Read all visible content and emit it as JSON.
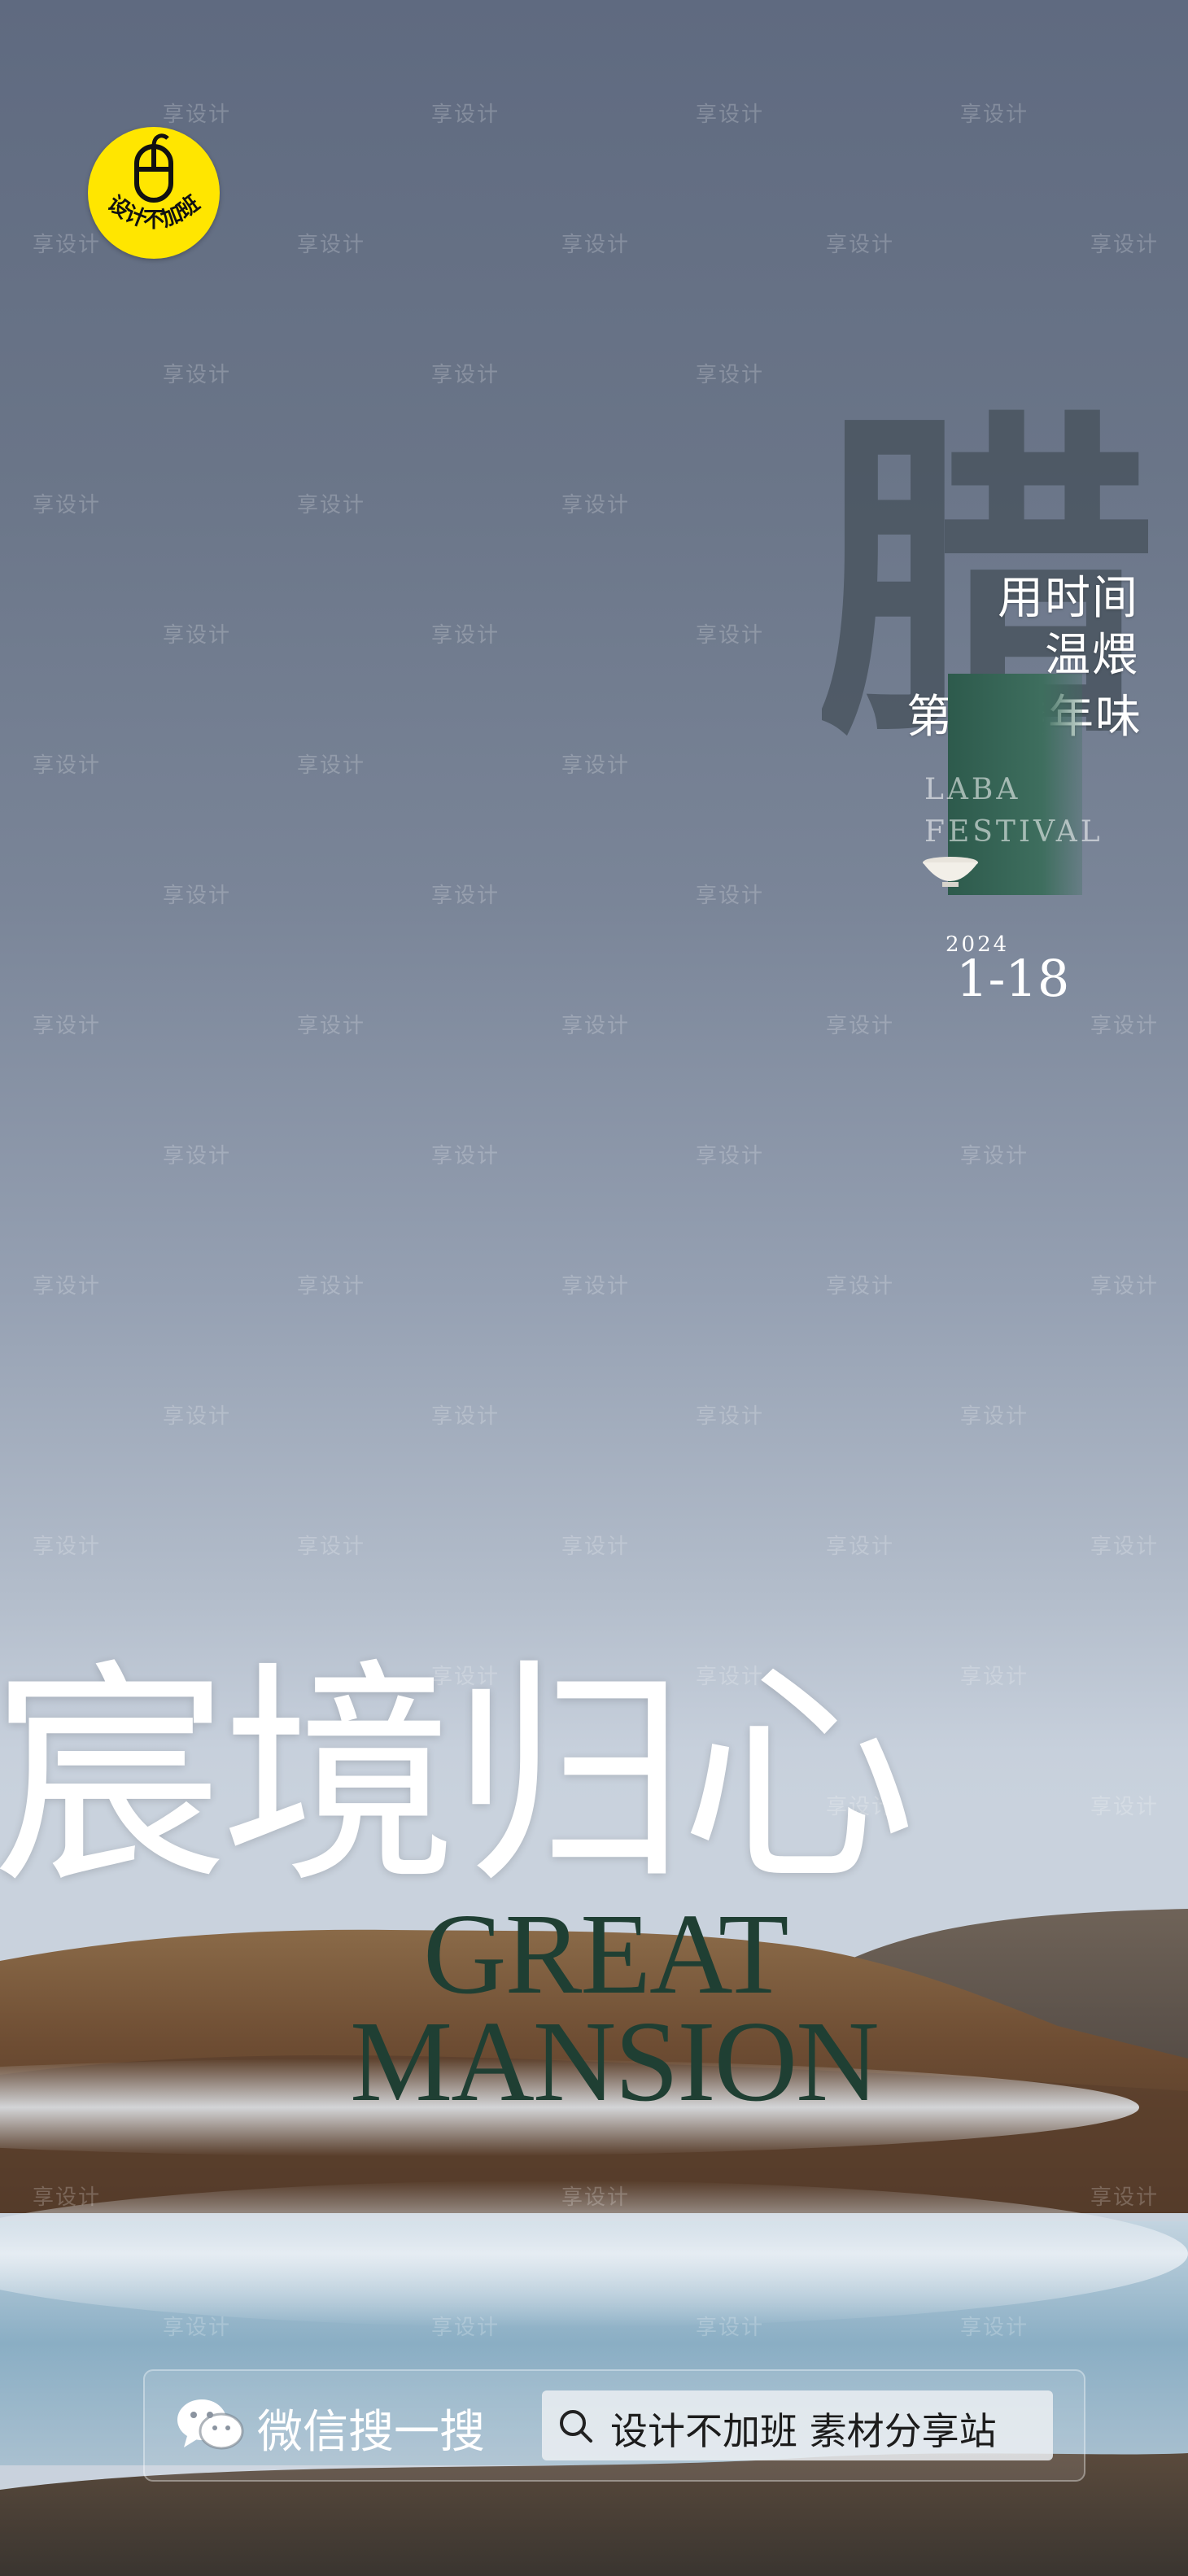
{
  "logo": {
    "text": "设计不加班",
    "icon": "mouse-icon",
    "color": "#ffe600"
  },
  "brush_character": "腊",
  "tagline": [
    "用时间",
    "温煨",
    "第一缕年味"
  ],
  "festival_text": [
    "LABA",
    "FESTIVAL"
  ],
  "date": {
    "year": "2024",
    "day": "1-18"
  },
  "headline": "宸境归心",
  "english": [
    "GREAT",
    "MANSION"
  ],
  "watermark": "享设计",
  "search_bar": {
    "wechat_label": "微信搜一搜",
    "query": "设计不加班 素材分享站",
    "icons": [
      "wechat-icon",
      "search-icon"
    ]
  },
  "colors": {
    "accent_green": "#2d5a4c",
    "sky_top": "#5f6a80",
    "sky_bottom": "#c9d2dd"
  }
}
